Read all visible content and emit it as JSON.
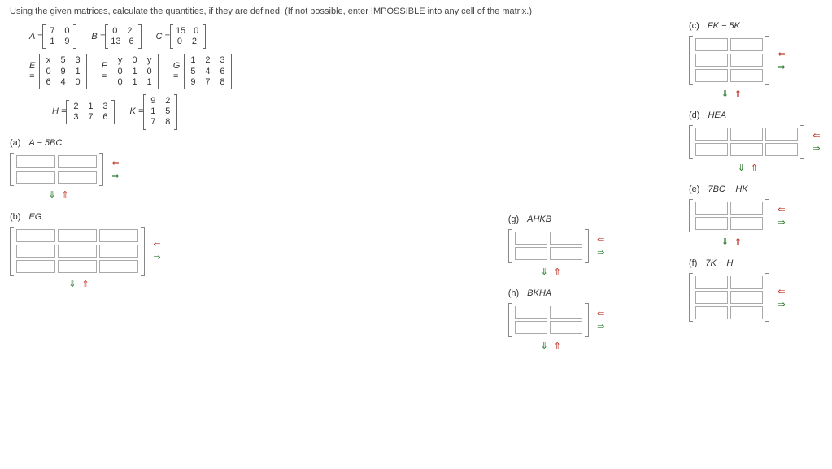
{
  "instruction": "Using the given matrices, calculate the quantities, if they are defined. (If not possible, enter IMPOSSIBLE into any cell of the matrix.)",
  "matrices": {
    "A": {
      "label": "A =",
      "rows": [
        [
          "7",
          "0"
        ],
        [
          "1",
          "9"
        ]
      ]
    },
    "B": {
      "label": "B =",
      "rows": [
        [
          "0",
          "2"
        ],
        [
          "13",
          "6"
        ]
      ]
    },
    "C": {
      "label": "C =",
      "rows": [
        [
          "15",
          "0"
        ],
        [
          "0",
          "2"
        ]
      ]
    },
    "E": {
      "label": "E =",
      "rows": [
        [
          "x",
          "5",
          "3"
        ],
        [
          "0",
          "9",
          "1"
        ],
        [
          "6",
          "4",
          "0"
        ]
      ]
    },
    "F": {
      "label": "F =",
      "rows": [
        [
          "y",
          "0",
          "y"
        ],
        [
          "0",
          "1",
          "0"
        ],
        [
          "0",
          "1",
          "1"
        ]
      ]
    },
    "G": {
      "label": "G =",
      "rows": [
        [
          "1",
          "2",
          "3"
        ],
        [
          "5",
          "4",
          "6"
        ],
        [
          "9",
          "7",
          "8"
        ]
      ]
    },
    "H": {
      "label": "H =",
      "rows": [
        [
          "2",
          "1",
          "3"
        ],
        [
          "3",
          "7",
          "6"
        ]
      ]
    },
    "K": {
      "label": "K =",
      "rows": [
        [
          "9",
          "2"
        ],
        [
          "1",
          "5"
        ],
        [
          "7",
          "8"
        ]
      ]
    }
  },
  "parts": {
    "a": {
      "label": "(a)",
      "expr": "A − 5BC"
    },
    "b": {
      "label": "(b)",
      "expr": "EG"
    },
    "c": {
      "label": "(c)",
      "expr": "FK − 5K"
    },
    "d": {
      "label": "(d)",
      "expr": "HEA"
    },
    "e": {
      "label": "(e)",
      "expr": "7BC − HK"
    },
    "f": {
      "label": "(f)",
      "expr": "7K − H"
    },
    "g": {
      "label": "(g)",
      "expr": "AHKB"
    },
    "h": {
      "label": "(h)",
      "expr": "BKHA"
    }
  },
  "chart_data": {
    "type": "table",
    "title": "Matrix answer grids (blank inputs)",
    "grids": {
      "a": {
        "rows": 2,
        "cols": 2
      },
      "b": {
        "rows": 3,
        "cols": 3
      },
      "c": {
        "rows": 3,
        "cols": 2
      },
      "d": {
        "rows": 2,
        "cols": 3
      },
      "e": {
        "rows": 2,
        "cols": 2
      },
      "f": {
        "rows": 3,
        "cols": 2
      },
      "g": {
        "rows": 2,
        "cols": 2
      },
      "h": {
        "rows": 2,
        "cols": 2
      }
    }
  }
}
